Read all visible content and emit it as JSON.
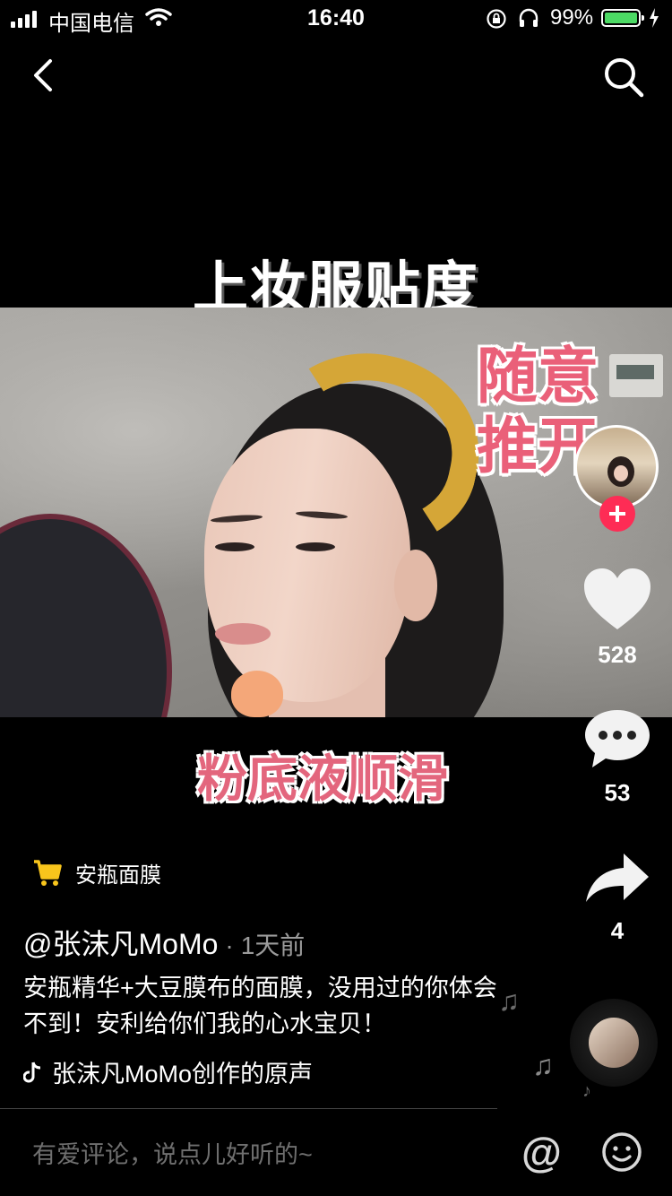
{
  "status_bar": {
    "carrier": "中国电信",
    "time": "16:40",
    "battery_percent": "99%",
    "battery_color": "#4cd964"
  },
  "video": {
    "caption_top": "上妆服贴度",
    "caption_right_line1": "随意",
    "caption_right_line2": "推开",
    "caption_bottom": "粉底液顺滑"
  },
  "actions": {
    "likes": "528",
    "comments": "53",
    "shares": "4",
    "accent_color": "#fe2c55"
  },
  "product": {
    "label": "安瓶面膜",
    "icon": "cart-icon",
    "icon_color": "#f8c51c"
  },
  "post": {
    "author": "@张沫凡MoMo",
    "separator": "·",
    "time_ago": "1天前",
    "description": "安瓶精华+大豆膜布的面膜，没用过的你体会不到！安利给你们我的心水宝贝！",
    "music": "张沫凡MoMo创作的原声"
  },
  "comment_bar": {
    "placeholder": "有爱评论，说点儿好听的~",
    "at_symbol": "@"
  }
}
